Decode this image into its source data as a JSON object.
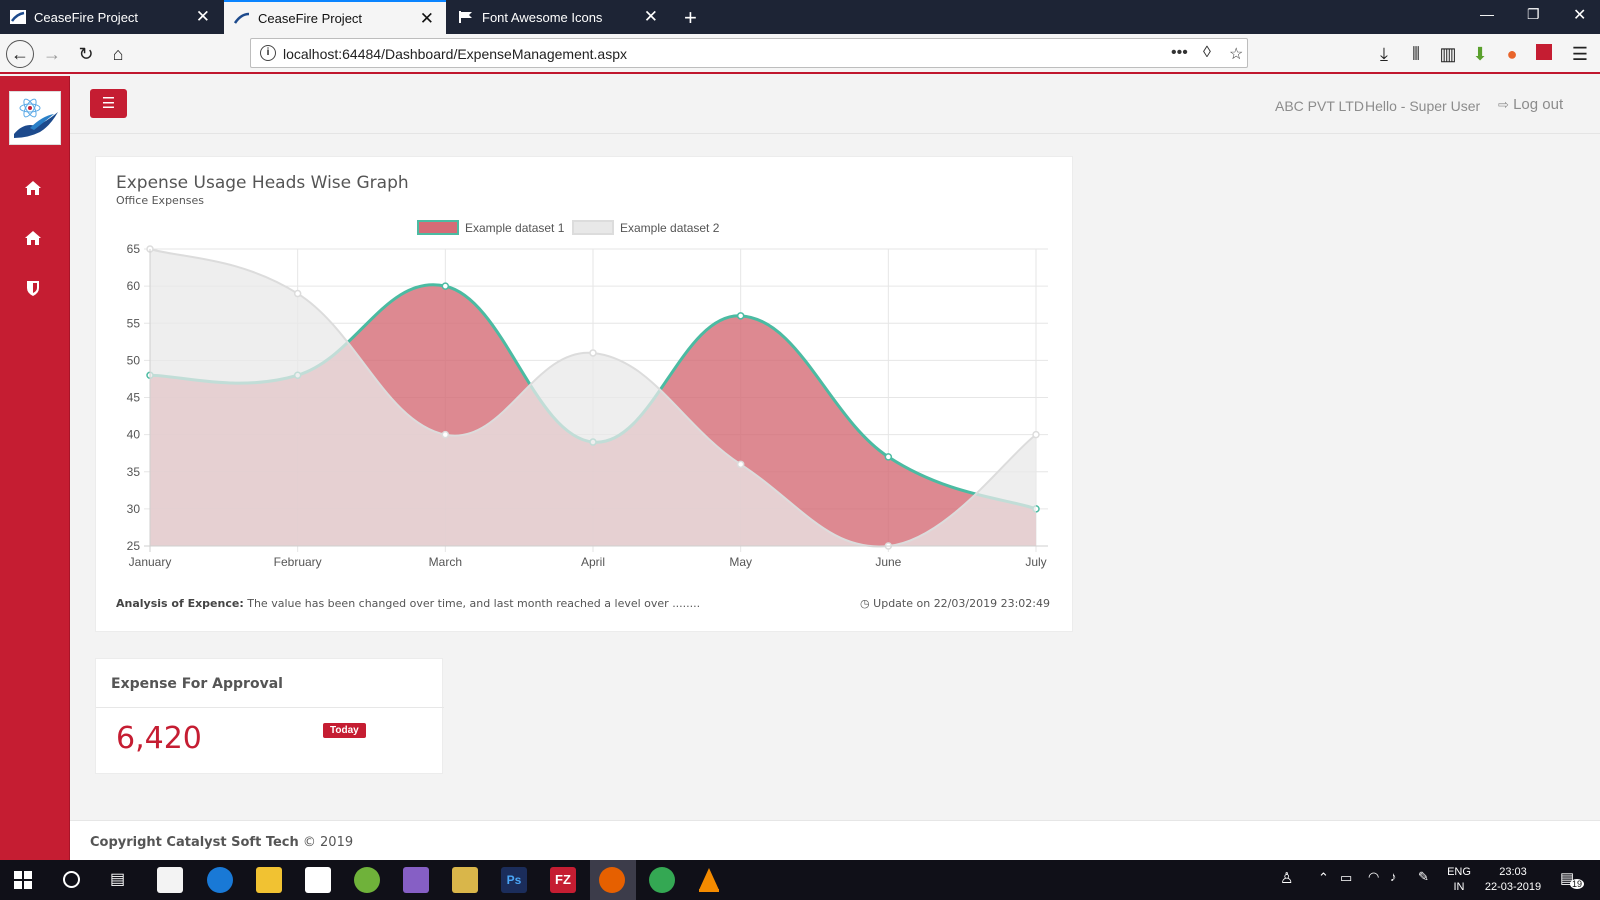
{
  "browser": {
    "tabs": [
      {
        "title": "CeaseFire Project",
        "active": false
      },
      {
        "title": "CeaseFire Project",
        "active": true
      },
      {
        "title": "Font Awesome Icons",
        "active": false
      }
    ],
    "url": "localhost:64484/Dashboard/ExpenseManagement.aspx"
  },
  "header": {
    "company": "ABC PVT LTD",
    "greeting": "Hello - Super User",
    "logout": "Log out"
  },
  "chart_card": {
    "title": "Expense Usage Heads Wise Graph",
    "subtitle": "Office Expenses",
    "analysis_label": "Analysis of Expence:",
    "analysis_text": "The value has been changed over time, and last month reached a level over ........",
    "update_text": "Update on 22/03/2019 23:02:49"
  },
  "chart_data": {
    "type": "area",
    "categories": [
      "January",
      "February",
      "March",
      "April",
      "May",
      "June",
      "July"
    ],
    "ylim": [
      25,
      65
    ],
    "yticks": [
      25,
      30,
      35,
      40,
      45,
      50,
      55,
      60,
      65
    ],
    "legend_position": "top",
    "grid": true,
    "series": [
      {
        "name": "Example dataset 1",
        "values": [
          48,
          48,
          60,
          39,
          56,
          37,
          30
        ],
        "fill": "#d56b76",
        "stroke": "#4bbba2"
      },
      {
        "name": "Example dataset 2",
        "values": [
          65,
          59,
          40,
          51,
          36,
          25,
          40
        ],
        "fill": "#e8e8e8",
        "stroke": "#dcdcdc"
      }
    ]
  },
  "approval": {
    "title": "Expense For Approval",
    "value": "6,420",
    "badge": "Today"
  },
  "footer": {
    "brand": "Copyright Catalyst Soft Tech",
    "year": "© 2019"
  },
  "taskbar": {
    "lang": "ENG",
    "region": "IN",
    "time": "23:03",
    "date": "22-03-2019",
    "notifications": "19"
  }
}
